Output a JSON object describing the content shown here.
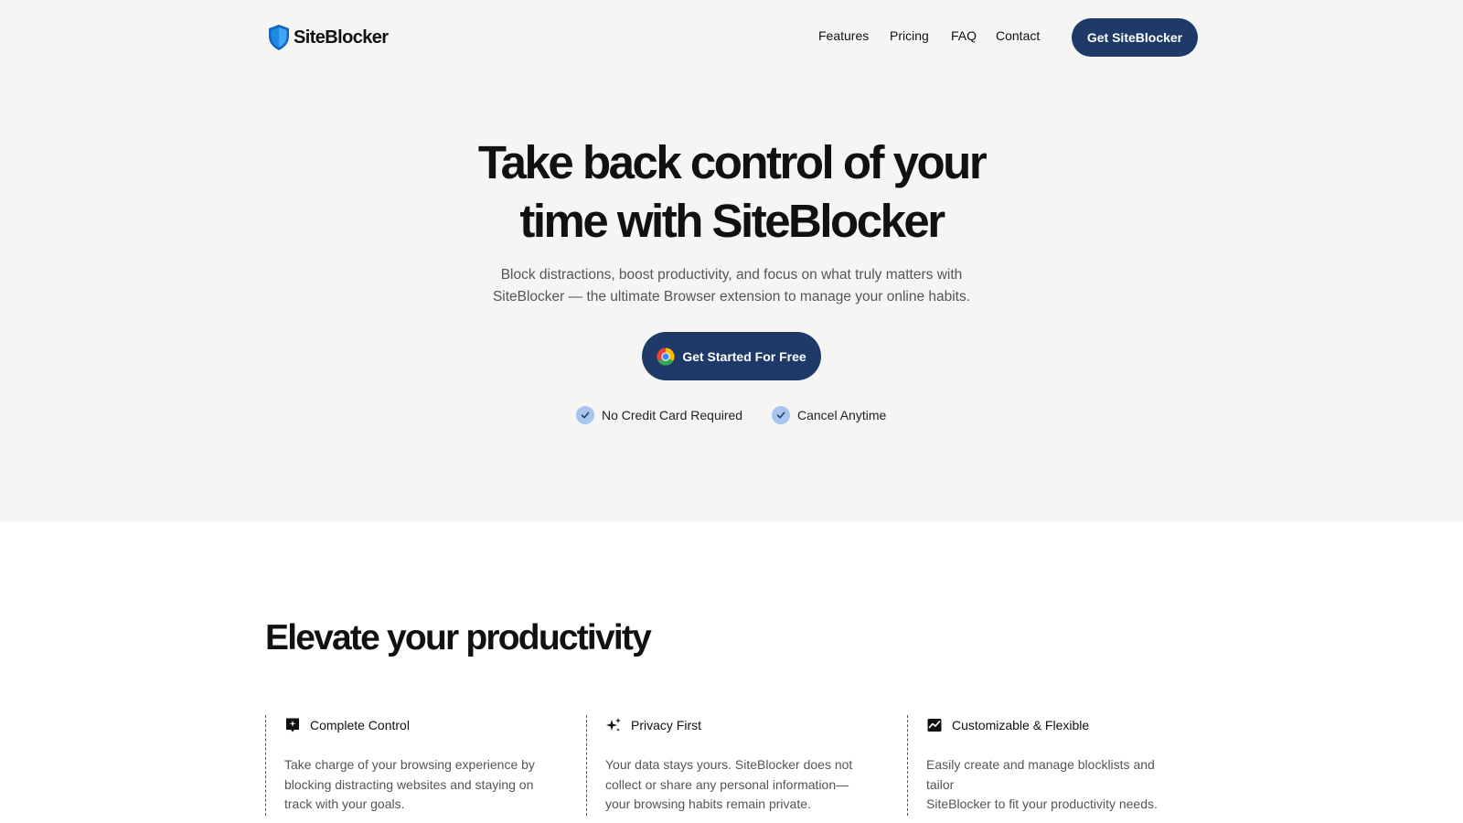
{
  "brand": {
    "name": "SiteBlocker",
    "logo_icon": "shield-icon"
  },
  "nav": {
    "links": [
      "Features",
      "Pricing",
      "FAQ",
      "Contact"
    ],
    "cta_label": "Get SiteBlocker"
  },
  "hero": {
    "headline_lines": [
      "Take back control of your",
      "time with SiteBlocker"
    ],
    "subtitle_lines": [
      "Block distractions, boost productivity, and focus on what truly matters with",
      "SiteBlocker — the ultimate Browser extension to manage your online habits."
    ],
    "cta_label": "Get Started For Free",
    "cta_icon": "chrome-icon",
    "checks": [
      "No Credit Card Required",
      "Cancel Anytime"
    ]
  },
  "features_section": {
    "title": "Elevate your productivity",
    "items": [
      {
        "title": "Complete Control",
        "icon": "control-icon",
        "desc_lines": [
          "Take charge of your browsing experience by",
          "blocking distracting websites and staying on",
          "track with your goals."
        ]
      },
      {
        "title": "Privacy First",
        "icon": "sparkles-icon",
        "desc_lines": [
          "Your data stays yours. SiteBlocker does not",
          "collect or share any personal information—",
          "your browsing habits remain private."
        ]
      },
      {
        "title": "Customizable & Flexible",
        "icon": "chart-icon",
        "desc_lines": [
          "Easily create and manage blocklists and tailor",
          "SiteBlocker to fit your productivity needs."
        ]
      }
    ]
  },
  "colors": {
    "accent": "#1f3a68",
    "hero_bg": "#f5f5f4",
    "check_bg": "#a8c5f0",
    "shield_blue": "#1e88e5"
  }
}
